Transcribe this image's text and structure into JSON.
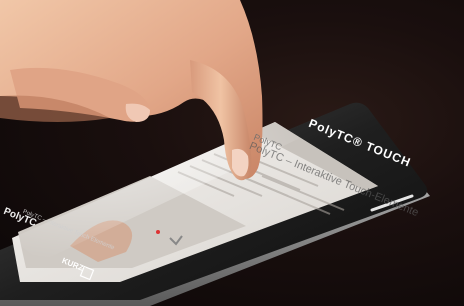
{
  "phone": {
    "brand_name": "PolyTC® TOUCH",
    "bezel_logo": "PolyTC",
    "bottom_logo": "KURZ"
  },
  "screen": {
    "site_title": "PolyTC",
    "heading": "PolyTC – Interaktive Touch-Elemente",
    "video_caption": "PolyTC – interaktive Touch Elemente"
  },
  "colors": {
    "background": "#1a0f0e",
    "phone_frame": "#2b2b2b",
    "phone_edge": "#bfbfbf",
    "screen": "#e9e6e2"
  }
}
